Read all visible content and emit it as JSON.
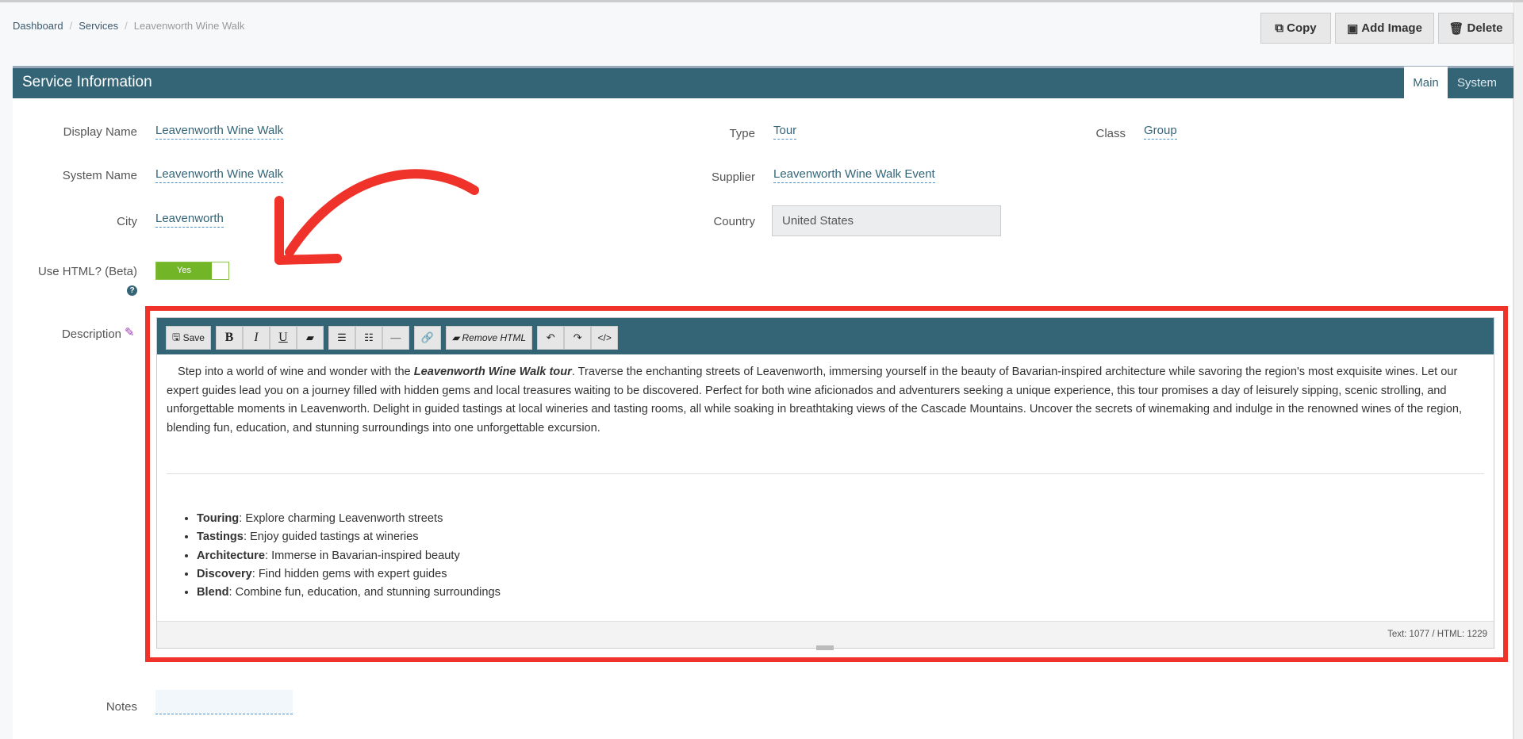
{
  "breadcrumb": [
    "Dashboard",
    "Services",
    "Leavenworth Wine Walk"
  ],
  "toolbar": {
    "copy": "Copy",
    "add_image": "Add Image",
    "delete": "Delete"
  },
  "panel": {
    "title": "Service Information",
    "tabs": [
      "Main",
      "System"
    ]
  },
  "fields": {
    "display_name": {
      "label": "Display Name",
      "value": "Leavenworth Wine Walk"
    },
    "system_name": {
      "label": "System Name",
      "value": "Leavenworth Wine Walk"
    },
    "city": {
      "label": "City",
      "value": "Leavenworth"
    },
    "type": {
      "label": "Type",
      "value": "Tour"
    },
    "supplier": {
      "label": "Supplier",
      "value": "Leavenworth Wine Walk Event"
    },
    "country": {
      "label": "Country",
      "value": "United States"
    },
    "class": {
      "label": "Class",
      "value": "Group"
    },
    "use_html": {
      "label": "Use HTML? (Beta)",
      "value": "Yes"
    },
    "description": {
      "label": "Description"
    },
    "notes": {
      "label": "Notes",
      "value": ""
    }
  },
  "editor": {
    "buttons": {
      "save": "Save",
      "bold": "B",
      "italic": "I",
      "underline": "U",
      "remove_html": "Remove HTML",
      "code": "</>"
    },
    "intro_pre": "Step into a world of wine and wonder with the ",
    "intro_em": "Leavenworth Wine Walk tour",
    "intro_post": ". Traverse the enchanting streets of Leavenworth, immersing yourself in the beauty of Bavarian-inspired architecture while savoring the region's most exquisite wines. Let our expert guides lead you on a journey filled with hidden gems and local treasures waiting to be discovered. Perfect for both wine aficionados and adventurers seeking a unique experience, this tour promises a day of leisurely sipping, scenic strolling, and unforgettable moments in Leavenworth. Delight in guided tastings at local wineries and tasting rooms, all while soaking in breathtaking views of the Cascade Mountains. Uncover the secrets of winemaking and indulge in the renowned wines of the region, blending fun, education, and stunning surroundings into one unforgettable excursion.",
    "bullets": [
      {
        "term": "Touring",
        "text": ": Explore charming Leavenworth streets"
      },
      {
        "term": "Tastings",
        "text": ": Enjoy guided tastings at wineries"
      },
      {
        "term": "Architecture",
        "text": ": Immerse in Bavarian-inspired beauty"
      },
      {
        "term": "Discovery",
        "text": ": Find hidden gems with expert guides"
      },
      {
        "term": "Blend",
        "text": ": Combine fun, education, and stunning surroundings"
      }
    ],
    "counter": "Text: 1077 / HTML: 1229"
  },
  "colors": {
    "header": "#336577",
    "accent": "#f0332a",
    "toggle": "#72b526"
  }
}
